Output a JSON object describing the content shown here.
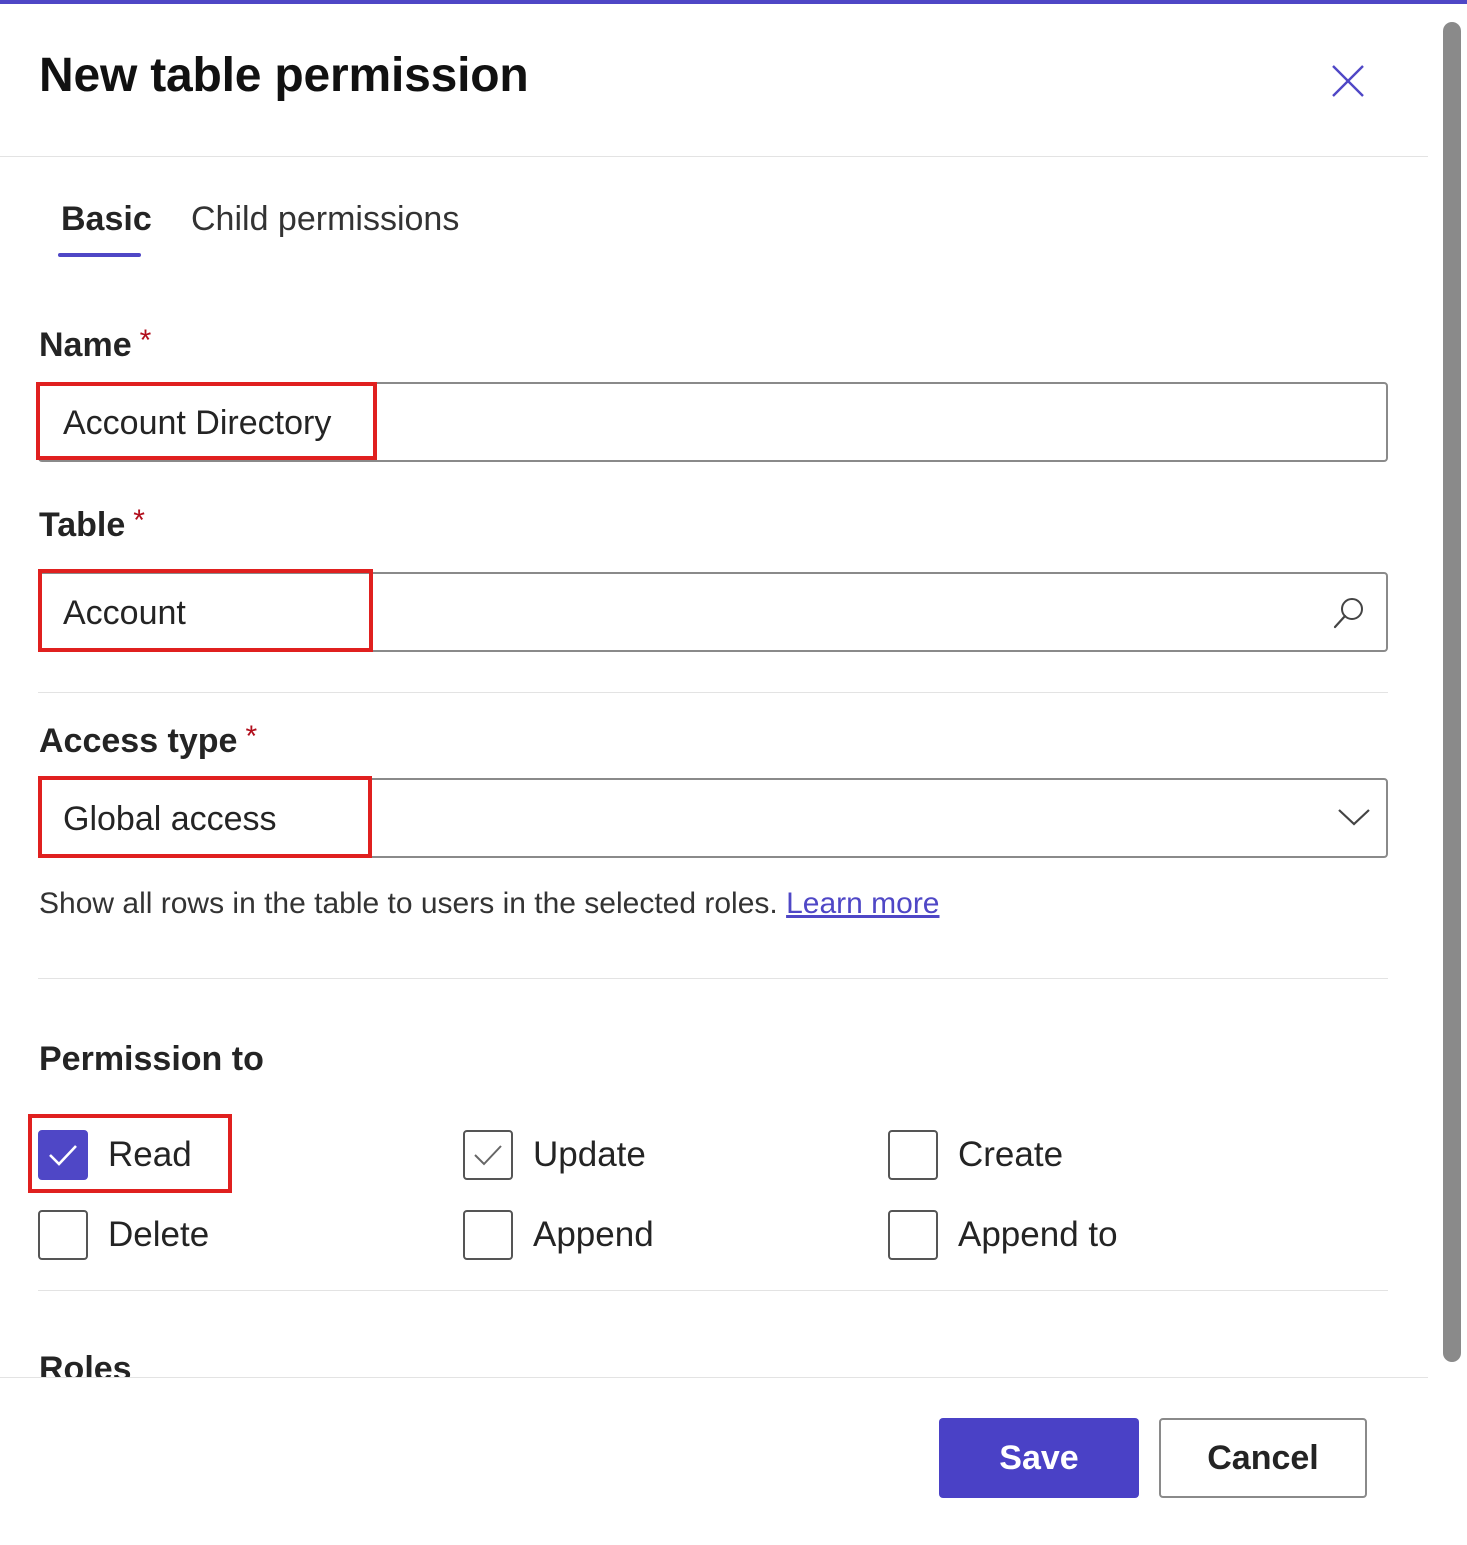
{
  "panel": {
    "title": "New table permission",
    "close_icon": "close-icon"
  },
  "tabs": [
    {
      "label": "Basic",
      "selected": true
    },
    {
      "label": "Child permissions",
      "selected": false
    }
  ],
  "form": {
    "name": {
      "label": "Name",
      "required_marker": "*",
      "value": "Account Directory"
    },
    "table": {
      "label": "Table",
      "required_marker": "*",
      "value": "Account",
      "icon": "search-icon"
    },
    "access_type": {
      "label": "Access type",
      "required_marker": "*",
      "value": "Global access",
      "icon": "chevron-down-icon",
      "helper_text": "Show all rows in the table to users in the selected roles.",
      "helper_link": "Learn more"
    },
    "permission_to": {
      "label": "Permission to",
      "options": [
        {
          "label": "Read",
          "checked": true,
          "style": "filled"
        },
        {
          "label": "Update",
          "checked": true,
          "style": "outline"
        },
        {
          "label": "Create",
          "checked": false
        },
        {
          "label": "Delete",
          "checked": false
        },
        {
          "label": "Append",
          "checked": false
        },
        {
          "label": "Append to",
          "checked": false
        }
      ]
    },
    "roles": {
      "label": "Roles"
    }
  },
  "footer": {
    "save_label": "Save",
    "cancel_label": "Cancel"
  },
  "colors": {
    "accent": "#4f47c6",
    "highlight": "#e0201f",
    "required": "#b10e1c"
  }
}
